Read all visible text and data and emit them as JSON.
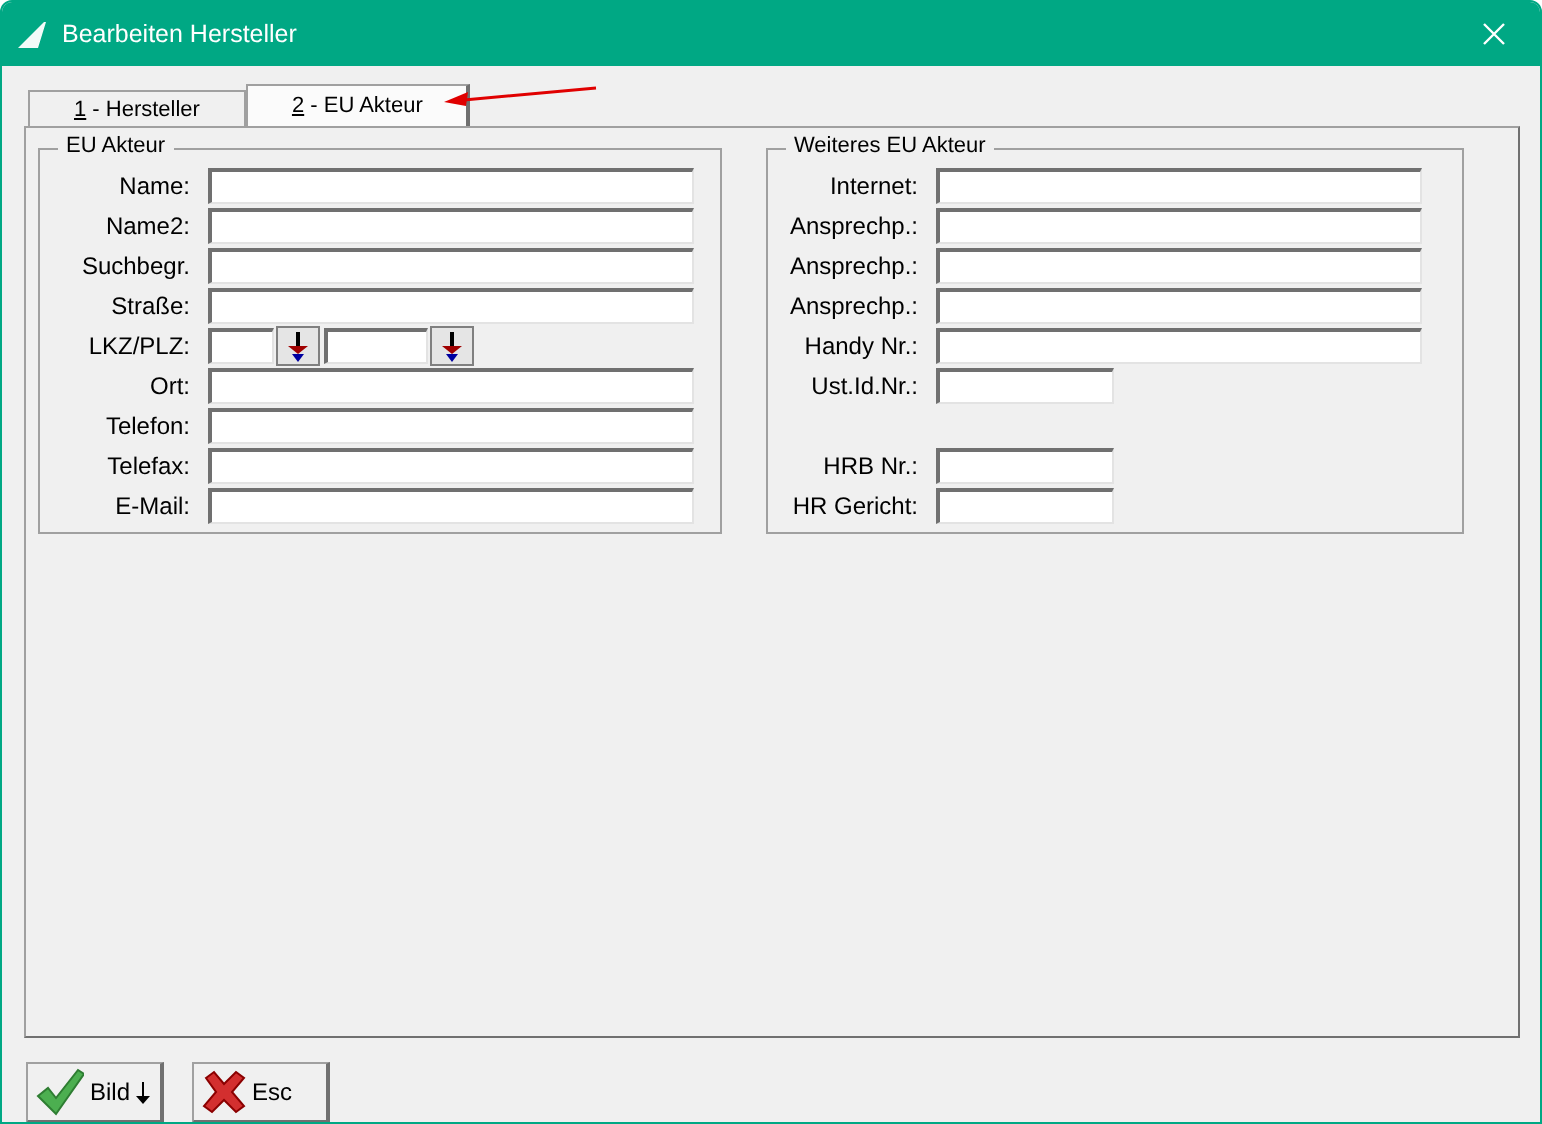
{
  "window": {
    "title": "Bearbeiten Hersteller"
  },
  "tabs": [
    {
      "key": "1",
      "rest": " - Hersteller",
      "selected": false
    },
    {
      "key": "2",
      "rest": " - EU Akteur",
      "selected": true
    }
  ],
  "groups": [
    {
      "title": "EU Akteur",
      "rows": [
        {
          "kind": "text",
          "label": "Name:"
        },
        {
          "kind": "text",
          "label": "Name2:"
        },
        {
          "kind": "text",
          "label": "Suchbegr."
        },
        {
          "kind": "text",
          "label": "Straße:"
        },
        {
          "kind": "pair",
          "label": "LKZ/PLZ:"
        },
        {
          "kind": "text",
          "label": "Ort:"
        },
        {
          "kind": "text",
          "label": "Telefon:"
        },
        {
          "kind": "text",
          "label": "Telefax:"
        },
        {
          "kind": "text",
          "label": "E-Mail:"
        }
      ]
    },
    {
      "title": "Weiteres EU Akteur",
      "rows": [
        {
          "kind": "text",
          "label": "Internet:"
        },
        {
          "kind": "text",
          "label": "Ansprechp.:"
        },
        {
          "kind": "text",
          "label": "Ansprechp.:"
        },
        {
          "kind": "text",
          "label": "Ansprechp.:"
        },
        {
          "kind": "text",
          "label": "Handy Nr.:"
        },
        {
          "kind": "short",
          "label": "Ust.Id.Nr.:"
        },
        {
          "kind": "gap"
        },
        {
          "kind": "short",
          "label": "HRB Nr.:"
        },
        {
          "kind": "short",
          "label": "HR Gericht:"
        }
      ]
    }
  ],
  "buttons": [
    {
      "kind": "ok",
      "label": "Bild"
    },
    {
      "kind": "cancel",
      "label": "Esc"
    }
  ]
}
